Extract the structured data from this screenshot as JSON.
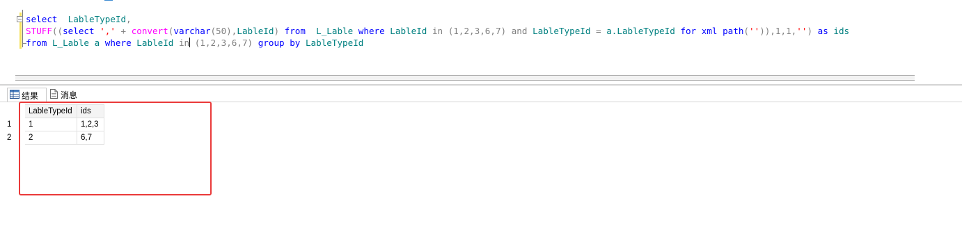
{
  "editor": {
    "lines": [
      [
        "select",
        "  ",
        "LableTypeId",
        ","
      ],
      [
        "STUFF",
        "((",
        "select",
        " ",
        "','",
        " + ",
        "convert",
        "(",
        "varchar",
        "(50),",
        "LableId",
        ")",
        " from ",
        " L_Lable ",
        "where",
        " ",
        "LableId",
        " ",
        "in",
        " (1,2,3,6,7) ",
        "and",
        " ",
        "LableTypeId",
        " = ",
        "a.LableTypeId",
        " ",
        "for",
        " ",
        "xml",
        " ",
        "path",
        "(",
        "''",
        ")),1,1,",
        "''",
        ")",
        " as ",
        "ids"
      ],
      [
        "from",
        " ",
        "L_Lable",
        " a ",
        "where",
        " ",
        "LableId",
        " ",
        "in",
        " (1,2,3,6,7) ",
        "group by",
        " ",
        "LableTypeId"
      ]
    ]
  },
  "tabs": {
    "results_label": "结果",
    "messages_label": "消息"
  },
  "grid": {
    "columns": [
      "LableTypeId",
      "ids"
    ],
    "rows": [
      {
        "num": "1",
        "cells": [
          "1",
          "1,2,3"
        ]
      },
      {
        "num": "2",
        "cells": [
          "2",
          "6,7"
        ]
      }
    ]
  },
  "colors": {
    "keyword": "#0000ff",
    "function": "#ff00ff",
    "string": "#ff0000",
    "identifier": "#008080",
    "operator": "#808080",
    "highlight_box": "#ea3a3a"
  }
}
